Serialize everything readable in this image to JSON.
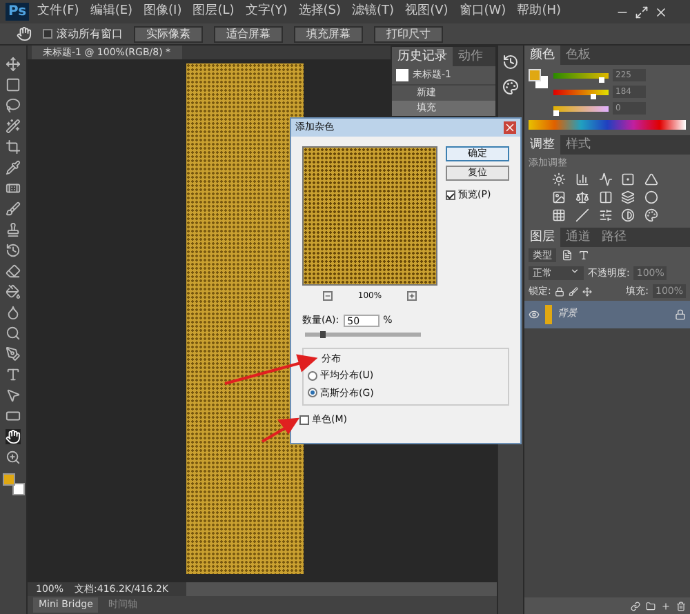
{
  "app": {
    "logo": "Ps",
    "menu": [
      "文件(F)",
      "编辑(E)",
      "图像(I)",
      "图层(L)",
      "文字(Y)",
      "选择(S)",
      "滤镜(T)",
      "视图(V)",
      "窗口(W)",
      "帮助(H)"
    ]
  },
  "options_bar": {
    "scroll_all": {
      "label": "滚动所有窗口",
      "checked": false
    },
    "buttons": [
      "实际像素",
      "适合屏幕",
      "填充屏幕",
      "打印尺寸"
    ]
  },
  "document_tab": {
    "title": "未标题-1 @ 100%(RGB/8) *"
  },
  "tools": [
    {
      "selected": false
    },
    {
      "selected": false
    },
    {
      "selected": false
    },
    {
      "selected": false
    },
    {
      "selected": false
    },
    {
      "selected": false
    },
    {
      "selected": false
    },
    {
      "selected": false
    },
    {
      "selected": false
    },
    {
      "selected": false
    },
    {
      "selected": false
    },
    {
      "selected": false
    },
    {
      "selected": false
    },
    {
      "selected": false
    },
    {
      "selected": false
    },
    {
      "selected": false
    },
    {
      "selected": false
    },
    {
      "selected": false
    },
    {
      "selected": true
    },
    {
      "selected": false
    }
  ],
  "history_panel": {
    "tabs": [
      {
        "label": "历史记录",
        "selected": true
      },
      {
        "label": "动作",
        "selected": false
      }
    ],
    "snapshot": "未标题-1",
    "items": [
      {
        "label": "新建",
        "selected": false
      },
      {
        "label": "填充",
        "selected": true
      }
    ]
  },
  "color_panel": {
    "tabs": [
      {
        "label": "颜色",
        "selected": true
      },
      {
        "label": "色板",
        "selected": false
      }
    ],
    "channels": [
      {
        "level": 0.88,
        "value": "225"
      },
      {
        "level": 0.72,
        "value": "184"
      },
      {
        "level": 0.05,
        "value": "0"
      }
    ]
  },
  "adjustments_panel": {
    "tabs": [
      {
        "label": "调整",
        "selected": true
      },
      {
        "label": "样式",
        "selected": false
      }
    ],
    "heading": "添加调整"
  },
  "layers_panel": {
    "tabs": [
      {
        "label": "图层",
        "selected": true
      },
      {
        "label": "通道",
        "selected": false
      },
      {
        "label": "路径",
        "selected": false
      }
    ],
    "filter": "类型",
    "blend_mode": "正常",
    "opacity_label": "不透明度:",
    "opacity": "100%",
    "lock_label": "锁定:",
    "fill_label": "填充:",
    "fill": "100%",
    "layers": [
      {
        "name": "背景",
        "selected": true,
        "visible": true
      }
    ]
  },
  "status_bar": {
    "zoom": "100%",
    "doc_info": "文档:416.2K/416.2K"
  },
  "bottom_tabs": [
    {
      "label": "Mini Bridge",
      "selected": true
    },
    {
      "label": "时间轴",
      "selected": false
    }
  ],
  "dialog": {
    "title": "添加杂色",
    "ok": "确定",
    "reset": "复位",
    "preview": {
      "label": "预览(P)",
      "checked": true
    },
    "zoom": "100%",
    "amount_label": "数量(A):",
    "amount": "50",
    "amount_unit": "%",
    "amount_slider": {
      "level": 0.125
    },
    "distribution": {
      "title": "分布",
      "options": [
        {
          "label": "平均分布(U)",
          "selected": false
        },
        {
          "label": "高斯分布(G)",
          "selected": true
        }
      ]
    },
    "monochrome": {
      "label": "单色(M)",
      "checked": false
    }
  }
}
